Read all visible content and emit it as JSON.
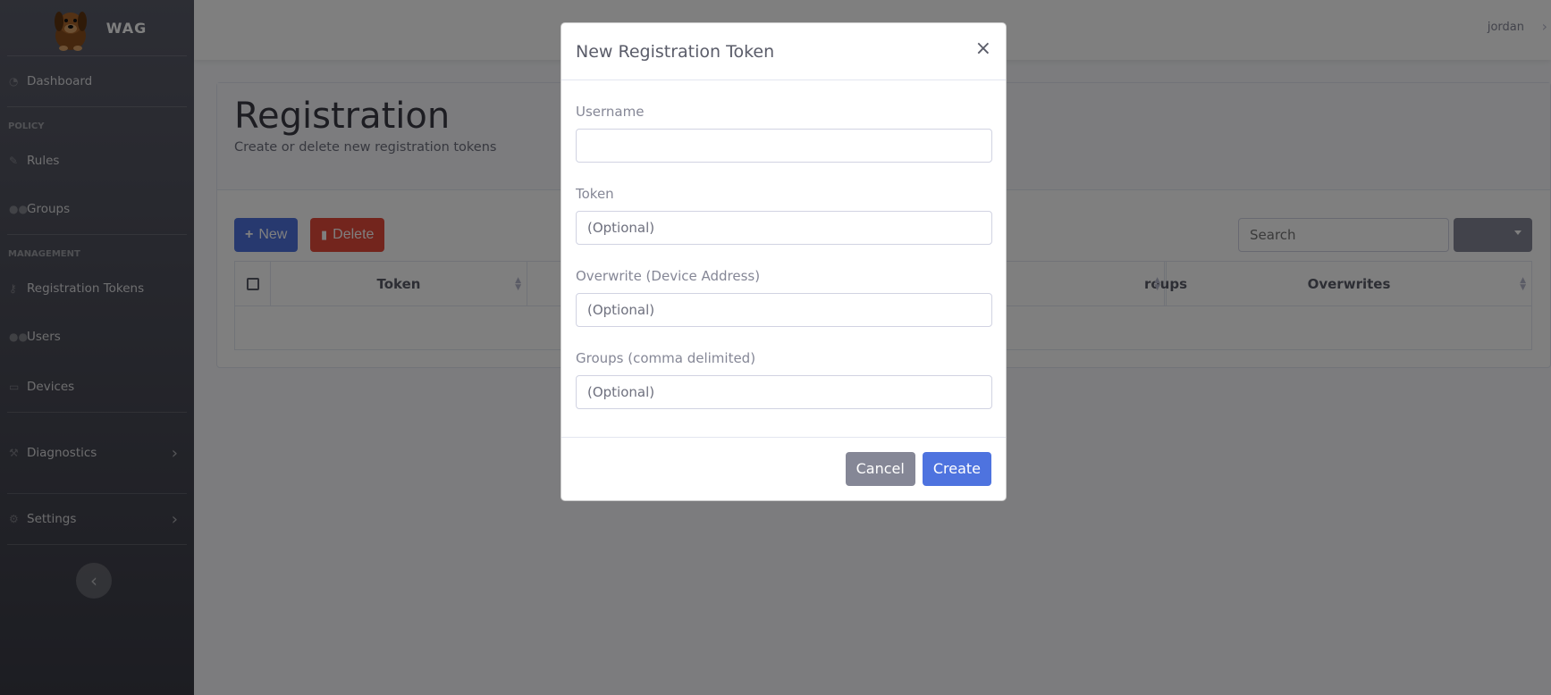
{
  "brand": {
    "name": "WAG",
    "logo_icon": "dog-logo"
  },
  "sidebar": {
    "dashboard": "Dashboard",
    "policy_heading": "POLICY",
    "rules": "Rules",
    "groups": "Groups",
    "management_heading": "MANAGEMENT",
    "registration_tokens": "Registration Tokens",
    "users": "Users",
    "devices": "Devices",
    "diagnostics": "Diagnostics",
    "settings": "Settings"
  },
  "topbar": {
    "username": "jordan"
  },
  "page": {
    "title": "Registration",
    "subtitle": "Create or delete new registration tokens",
    "new_label": "New",
    "delete_label": "Delete",
    "search_placeholder": "Search",
    "columns": [
      "Token",
      "",
      "roups",
      "Overwrites"
    ]
  },
  "modal": {
    "title": "New Registration Token",
    "close": "×",
    "fields": [
      {
        "label": "Username",
        "placeholder": ""
      },
      {
        "label": "Token",
        "placeholder": "(Optional)"
      },
      {
        "label": "Overwrite (Device Address)",
        "placeholder": "(Optional)"
      },
      {
        "label": "Groups (comma delimited)",
        "placeholder": "(Optional)"
      }
    ],
    "cancel": "Cancel",
    "create": "Create"
  },
  "colors": {
    "primary": "#4e73df",
    "danger": "#e74a3b",
    "secondary": "#858796",
    "sidebar": "#3a3b45"
  }
}
